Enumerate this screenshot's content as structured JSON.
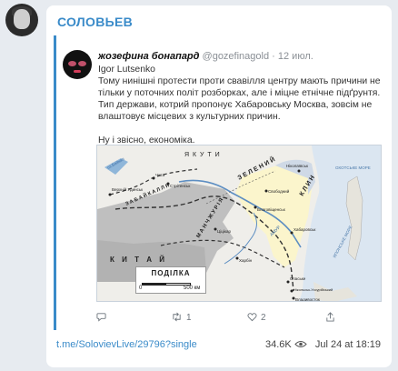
{
  "channel": {
    "name": "СОЛОВЬЕВ"
  },
  "tweet": {
    "author_name": "жозефина бонапард",
    "author_handle": "@gozefinagold",
    "separator": "·",
    "date": "12 июл.",
    "paragraphs": [
      "Igor Lutsenko",
      "Тому нинішні протести проти свавілля центру мають причини не тільки у поточних політ розборках, але і міцне етнічне підґрунтя. Тип держави, котрий пропонує Хабаровську Москва, зовсім не влаштовує місцевих з культурних причин.",
      "",
      "Ну і звісно, економіка."
    ],
    "actions": {
      "reply_count": "",
      "retweet_count": "1",
      "like_count": "2"
    }
  },
  "map": {
    "legend_title": "ПОДІЛКА",
    "scale_start": "0",
    "scale_end": "500 км",
    "labels": {
      "yakuty": "Я К У Т И",
      "zelenyi": "З Е Л Е Н И Й",
      "klyn": "К Л И Н",
      "zabaikalia": "З А Б А Й К А Л Л Я",
      "manchzhuria": "М А Н Ч Ж У Р І Я",
      "kytai": "К И Т А Й",
      "okhotske": "ОХОТСЬКЕ МОРЕ",
      "yaponske": "ЯПОНСЬКЕ МОРЕ",
      "amur": "АМУР",
      "baikal": "оз.Байкал",
      "verkhnyi": "Верхній Удинськ",
      "chyta": "Чита",
      "sretenske": "Стрітенськ",
      "nykolaivsk": "Ніколаївськ",
      "svobodnyi": "Свободний",
      "blagovishchensk": "Благовіщенськ",
      "khabarovsk": "Хабаровськ",
      "tsitsikar": "Ціцікар",
      "kharbin": "Харбін",
      "spaske": "Спаське",
      "nykolsk": "Нікольськ-Уссурійський",
      "vladyvostok": "Владивосток"
    }
  },
  "footer": {
    "link": "t.me/SolovievLive/29796?single",
    "views": "34.6K",
    "date": "Jul 24 at 18:19"
  }
}
